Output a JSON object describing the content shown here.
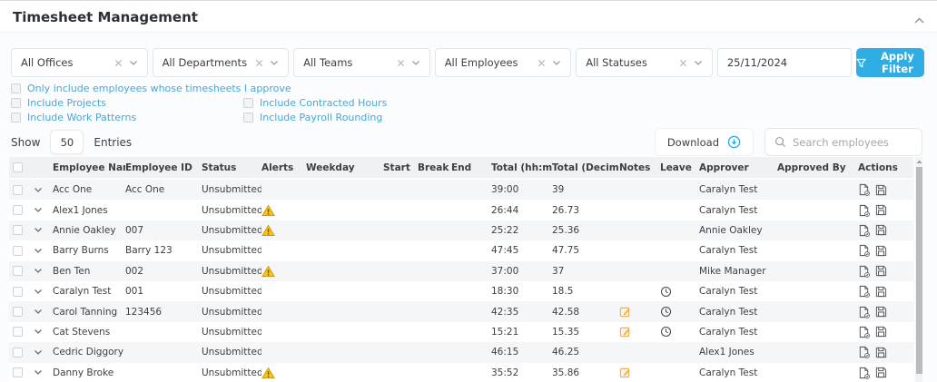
{
  "title": "Timesheet Management",
  "filters": {
    "dropdowns": [
      {
        "label": "All Offices"
      },
      {
        "label": "All Departments"
      },
      {
        "label": "All Teams"
      },
      {
        "label": "All Employees"
      },
      {
        "label": "All Statuses"
      }
    ],
    "date": "25/11/2024",
    "apply_label": "Apply Filter",
    "checkbox_row1": "Only include employees whose timesheets I approve",
    "checkboxes_left": [
      "Include Projects",
      "Include Work Patterns"
    ],
    "checkboxes_right": [
      "Include Contracted Hours",
      "Include Payroll Rounding"
    ]
  },
  "toolbar": {
    "show_label": "Show",
    "entries_value": "50",
    "entries_label": "Entries",
    "download_label": "Download",
    "search_placeholder": "Search employees"
  },
  "table": {
    "columns": [
      "Employee Name",
      "Employee ID",
      "Status",
      "Alerts",
      "Weekday",
      "Start",
      "Break",
      "End",
      "Total (hh:mm)",
      "Total (Decimal)",
      "Notes",
      "Leave",
      "Approver",
      "Approved By",
      "Actions"
    ],
    "rows": [
      {
        "name": "Acc One",
        "id": "Acc One",
        "status": "Unsubmitted",
        "alert": false,
        "weekday": "",
        "start": "",
        "break": "",
        "end": "",
        "total_hhmm": "39:00",
        "total_decimal": "39",
        "notes": false,
        "leave": false,
        "approver": "Caralyn Test",
        "approved_by": ""
      },
      {
        "name": "Alex1 Jones",
        "id": "",
        "status": "Unsubmitted",
        "alert": true,
        "weekday": "",
        "start": "",
        "break": "",
        "end": "",
        "total_hhmm": "26:44",
        "total_decimal": "26.73",
        "notes": false,
        "leave": false,
        "approver": "Caralyn Test",
        "approved_by": ""
      },
      {
        "name": "Annie Oakley",
        "id": "007",
        "status": "Unsubmitted",
        "alert": true,
        "weekday": "",
        "start": "",
        "break": "",
        "end": "",
        "total_hhmm": "25:22",
        "total_decimal": "25.36",
        "notes": false,
        "leave": false,
        "approver": "Annie Oakley",
        "approved_by": ""
      },
      {
        "name": "Barry Burns",
        "id": "Barry 123",
        "status": "Unsubmitted",
        "alert": false,
        "weekday": "",
        "start": "",
        "break": "",
        "end": "",
        "total_hhmm": "47:45",
        "total_decimal": "47.75",
        "notes": false,
        "leave": false,
        "approver": "Caralyn Test",
        "approved_by": ""
      },
      {
        "name": "Ben Ten",
        "id": "002",
        "status": "Unsubmitted",
        "alert": true,
        "weekday": "",
        "start": "",
        "break": "",
        "end": "",
        "total_hhmm": "37:00",
        "total_decimal": "37",
        "notes": false,
        "leave": false,
        "approver": "Mike Manager",
        "approved_by": ""
      },
      {
        "name": "Caralyn Test",
        "id": "001",
        "status": "Unsubmitted",
        "alert": false,
        "weekday": "",
        "start": "",
        "break": "",
        "end": "",
        "total_hhmm": "18:30",
        "total_decimal": "18.5",
        "notes": false,
        "leave": true,
        "approver": "Caralyn Test",
        "approved_by": ""
      },
      {
        "name": "Carol Tanning",
        "id": "123456",
        "status": "Unsubmitted",
        "alert": false,
        "weekday": "",
        "start": "",
        "break": "",
        "end": "",
        "total_hhmm": "42:35",
        "total_decimal": "42.58",
        "notes": true,
        "leave": true,
        "approver": "Caralyn Test",
        "approved_by": ""
      },
      {
        "name": "Cat Stevens",
        "id": "",
        "status": "Unsubmitted",
        "alert": false,
        "weekday": "",
        "start": "",
        "break": "",
        "end": "",
        "total_hhmm": "15:21",
        "total_decimal": "15.35",
        "notes": true,
        "leave": true,
        "approver": "Caralyn Test",
        "approved_by": ""
      },
      {
        "name": "Cedric Diggory",
        "id": "",
        "status": "Unsubmitted",
        "alert": false,
        "weekday": "",
        "start": "",
        "break": "",
        "end": "",
        "total_hhmm": "46:15",
        "total_decimal": "46.25",
        "notes": false,
        "leave": false,
        "approver": "Alex1 Jones",
        "approved_by": ""
      },
      {
        "name": "Danny Broke",
        "id": "",
        "status": "Unsubmitted",
        "alert": true,
        "weekday": "",
        "start": "",
        "break": "",
        "end": "",
        "total_hhmm": "35:52",
        "total_decimal": "35.86",
        "notes": true,
        "leave": false,
        "approver": "Caralyn Test",
        "approved_by": ""
      }
    ]
  },
  "icons": {
    "collapse": "chevron-up-icon",
    "dropdown_clear": "x-clear-icon",
    "dropdown_open": "chevron-down-icon",
    "date": "calendar-icon",
    "apply": "funnel-icon",
    "download": "download-circle-icon",
    "search": "magnifier-icon",
    "alert": "warning-triangle-icon",
    "notes": "note-edit-icon",
    "leave": "clock-icon",
    "action1": "timesheet-report-icon",
    "action2": "save-floppy-icon",
    "scrollbar": "scroll-up-arrow-icon"
  },
  "colors": {
    "accent_blue": "#2fade4",
    "link_blue": "#45a7d9",
    "warning_yellow": "#f7c41d",
    "notes_orange": "#f1a93b",
    "row_stripe": "#f4f6f8",
    "header_gray": "#eff1f3"
  }
}
